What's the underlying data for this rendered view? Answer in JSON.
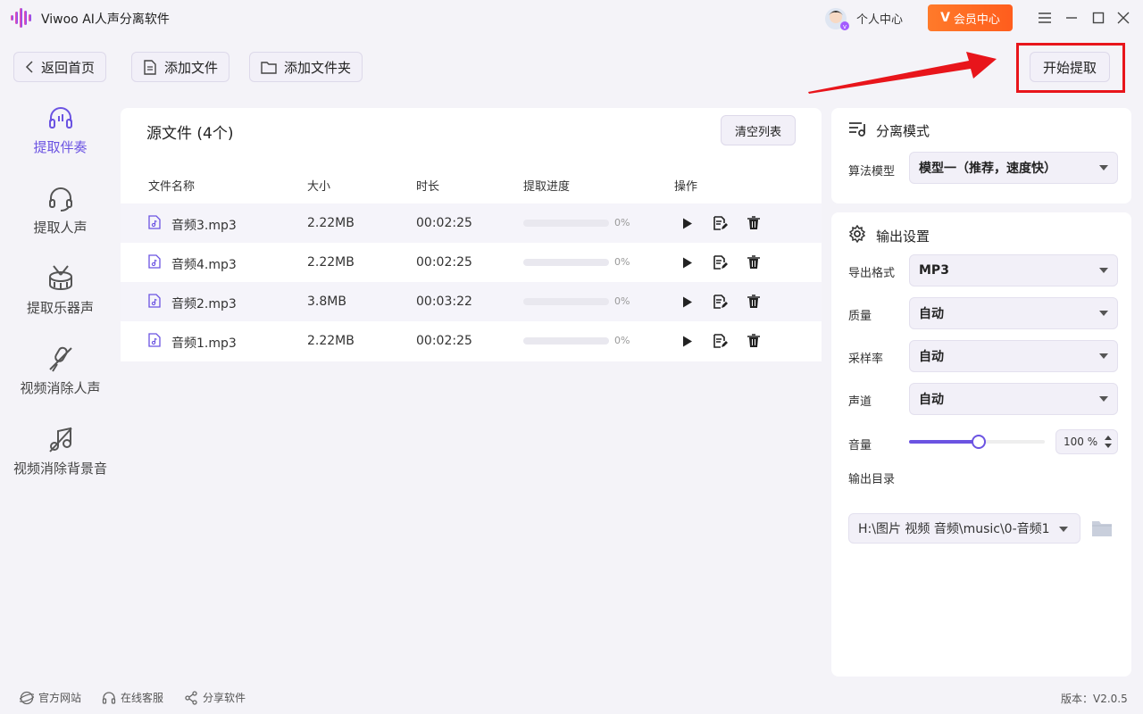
{
  "app": {
    "title": "Viwoo AI人声分离软件"
  },
  "header": {
    "user_center": "个人中心",
    "vip_label": "会员中心",
    "vip_mark": "V"
  },
  "toolbar": {
    "back": "返回首页",
    "add_file": "添加文件",
    "add_folder": "添加文件夹",
    "start": "开始提取"
  },
  "sidebar": {
    "items": [
      {
        "label": "提取伴奏",
        "icon": "headphones-icon",
        "active": true
      },
      {
        "label": "提取人声",
        "icon": "headset-mic-icon",
        "active": false
      },
      {
        "label": "提取乐器声",
        "icon": "drum-icon",
        "active": false
      },
      {
        "label": "视频消除人声",
        "icon": "mic-off-icon",
        "active": false
      },
      {
        "label": "视频消除背景音",
        "icon": "music-off-icon",
        "active": false
      }
    ]
  },
  "files": {
    "title": "源文件 (4个)",
    "clear": "清空列表",
    "columns": [
      "文件名称",
      "大小",
      "时长",
      "提取进度",
      "操作"
    ],
    "rows": [
      {
        "name": "音频3.mp3",
        "size": "2.22MB",
        "duration": "00:02:25",
        "progress": 0,
        "progress_text": "0%"
      },
      {
        "name": "音频4.mp3",
        "size": "2.22MB",
        "duration": "00:02:25",
        "progress": 0,
        "progress_text": "0%"
      },
      {
        "name": "音频2.mp3",
        "size": "3.8MB",
        "duration": "00:03:22",
        "progress": 0,
        "progress_text": "0%"
      },
      {
        "name": "音频1.mp3",
        "size": "2.22MB",
        "duration": "00:02:25",
        "progress": 0,
        "progress_text": "0%"
      }
    ]
  },
  "separation": {
    "title": "分离模式",
    "model_label": "算法模型",
    "model_value": "模型一（推荐，速度快）"
  },
  "output": {
    "title": "输出设置",
    "format_label": "导出格式",
    "format_value": "MP3",
    "quality_label": "质量",
    "quality_value": "自动",
    "samplerate_label": "采样率",
    "samplerate_value": "自动",
    "channel_label": "声道",
    "channel_value": "自动",
    "volume_label": "音量",
    "volume_value": 100,
    "volume_text": "100 %",
    "dir_label": "输出目录",
    "dir_value": "H:\\图片 视频 音频\\music\\0-音频1"
  },
  "footer": {
    "website": "官方网站",
    "support": "在线客服",
    "share": "分享软件",
    "version": "版本：V2.0.5"
  },
  "colors": {
    "accent": "#6b53e2",
    "vip": "#ff6a22",
    "highlight": "#e8151b"
  }
}
